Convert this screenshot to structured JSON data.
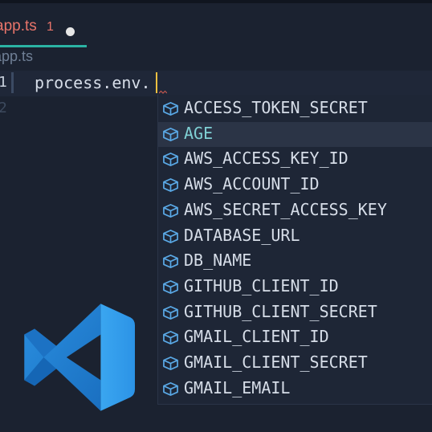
{
  "tab": {
    "file_name": "app.ts",
    "problem_count": "1",
    "unsaved_indicator": "modified-dot"
  },
  "breadcrumb": "app.ts",
  "editor": {
    "line_numbers": [
      "1",
      "2"
    ],
    "code_line": "process.env."
  },
  "suggestions": {
    "icon": "property-cube-icon",
    "selected_index": 1,
    "items": [
      "ACCESS_TOKEN_SECRET",
      "AGE",
      "AWS_ACCESS_KEY_ID",
      "AWS_ACCOUNT_ID",
      "AWS_SECRET_ACCESS_KEY",
      "DATABASE_URL",
      "DB_NAME",
      "GITHUB_CLIENT_ID",
      "GITHUB_CLIENT_SECRET",
      "GMAIL_CLIENT_ID",
      "GMAIL_CLIENT_SECRET",
      "GMAIL_EMAIL"
    ]
  },
  "logo": "vscode-logo",
  "colors": {
    "background": "#1b2230",
    "tab_error_text": "#e8746a",
    "tab_underline": "#2bb3a3",
    "cursor": "#f0c040",
    "selected_label": "#7fd0d4",
    "icon_blue": "#5aa9e6",
    "logo_blue": "#2f9fe8"
  }
}
